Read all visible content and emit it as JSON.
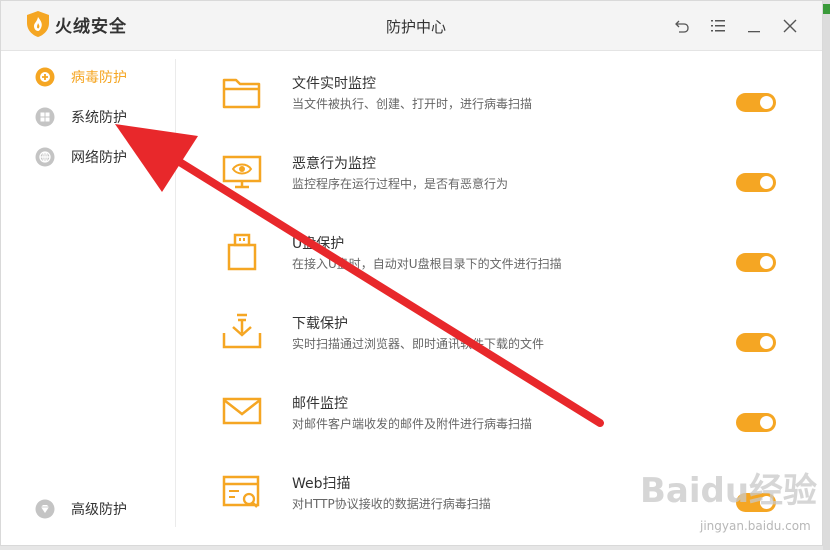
{
  "app": {
    "brand": "火绒安全",
    "title": "防护中心"
  },
  "colors": {
    "accent": "#f5a623",
    "text": "#333333",
    "subtext": "#666666",
    "arrow": "#e8282b"
  },
  "sidebar": {
    "items": [
      {
        "label": "病毒防护",
        "icon": "virus-protection-icon",
        "active": true
      },
      {
        "label": "系统防护",
        "icon": "windows-icon",
        "active": false
      },
      {
        "label": "网络防护",
        "icon": "globe-icon",
        "active": false
      }
    ],
    "bottom_item": {
      "label": "高级防护",
      "icon": "diamond-icon"
    }
  },
  "features": [
    {
      "title": "文件实时监控",
      "desc": "当文件被执行、创建、打开时，进行病毒扫描",
      "icon": "folder-icon",
      "enabled": true
    },
    {
      "title": "恶意行为监控",
      "desc": "监控程序在运行过程中，是否有恶意行为",
      "icon": "monitor-eye-icon",
      "enabled": true
    },
    {
      "title": "U盘保护",
      "desc": "在接入U盘时，自动对U盘根目录下的文件进行扫描",
      "icon": "usb-icon",
      "enabled": true
    },
    {
      "title": "下载保护",
      "desc": "实时扫描通过浏览器、即时通讯软件下载的文件",
      "icon": "download-icon",
      "enabled": true
    },
    {
      "title": "邮件监控",
      "desc": "对邮件客户端收发的邮件及附件进行病毒扫描",
      "icon": "mail-icon",
      "enabled": true
    },
    {
      "title": "Web扫描",
      "desc": "对HTTP协议接收的数据进行病毒扫描",
      "icon": "web-scan-icon",
      "enabled": true
    }
  ],
  "watermark": {
    "logo": "Baidu经验",
    "url": "jingyan.baidu.com"
  }
}
